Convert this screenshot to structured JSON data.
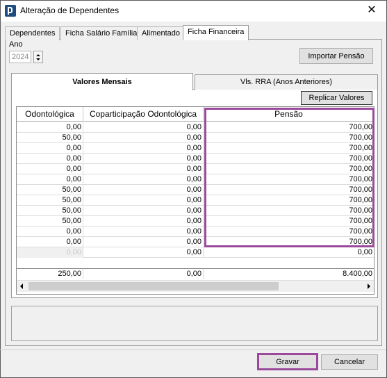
{
  "window": {
    "title": "Alteração de Dependentes",
    "close_glyph": "✕"
  },
  "tabs": [
    {
      "label": "Dependentes",
      "active": false
    },
    {
      "label": "Ficha Salário Família",
      "active": false
    },
    {
      "label": "Alimentado",
      "active": false
    },
    {
      "label": "Ficha Financeira",
      "active": true
    }
  ],
  "year": {
    "label": "Ano",
    "value": "2024"
  },
  "buttons": {
    "import_pension": "Importar Pensão",
    "replicate_values": "Replicar Valores",
    "save": "Gravar",
    "cancel": "Cancelar"
  },
  "subtabs": [
    {
      "label": "Valores Mensais",
      "active": true
    },
    {
      "label": "Vls. RRA (Anos Anteriores)",
      "active": false
    }
  ],
  "grid": {
    "columns": [
      "Odontológica",
      "Coparticipação Odontológica",
      "Pensão"
    ],
    "rows": [
      [
        "0,00",
        "0,00",
        "700,00"
      ],
      [
        "50,00",
        "0,00",
        "700,00"
      ],
      [
        "0,00",
        "0,00",
        "700,00"
      ],
      [
        "0,00",
        "0,00",
        "700,00"
      ],
      [
        "0,00",
        "0,00",
        "700,00"
      ],
      [
        "0,00",
        "0,00",
        "700,00"
      ],
      [
        "50,00",
        "0,00",
        "700,00"
      ],
      [
        "50,00",
        "0,00",
        "700,00"
      ],
      [
        "50,00",
        "0,00",
        "700,00"
      ],
      [
        "50,00",
        "0,00",
        "700,00"
      ],
      [
        "0,00",
        "0,00",
        "700,00"
      ],
      [
        "0,00",
        "0,00",
        "700,00"
      ]
    ],
    "new_row": [
      "0,00",
      "0,00",
      "0,00"
    ],
    "totals": [
      "250,00",
      "0,00",
      "8.400,00"
    ]
  },
  "colors": {
    "highlight": "#9b4a9b",
    "accent": "#1e4b80"
  }
}
